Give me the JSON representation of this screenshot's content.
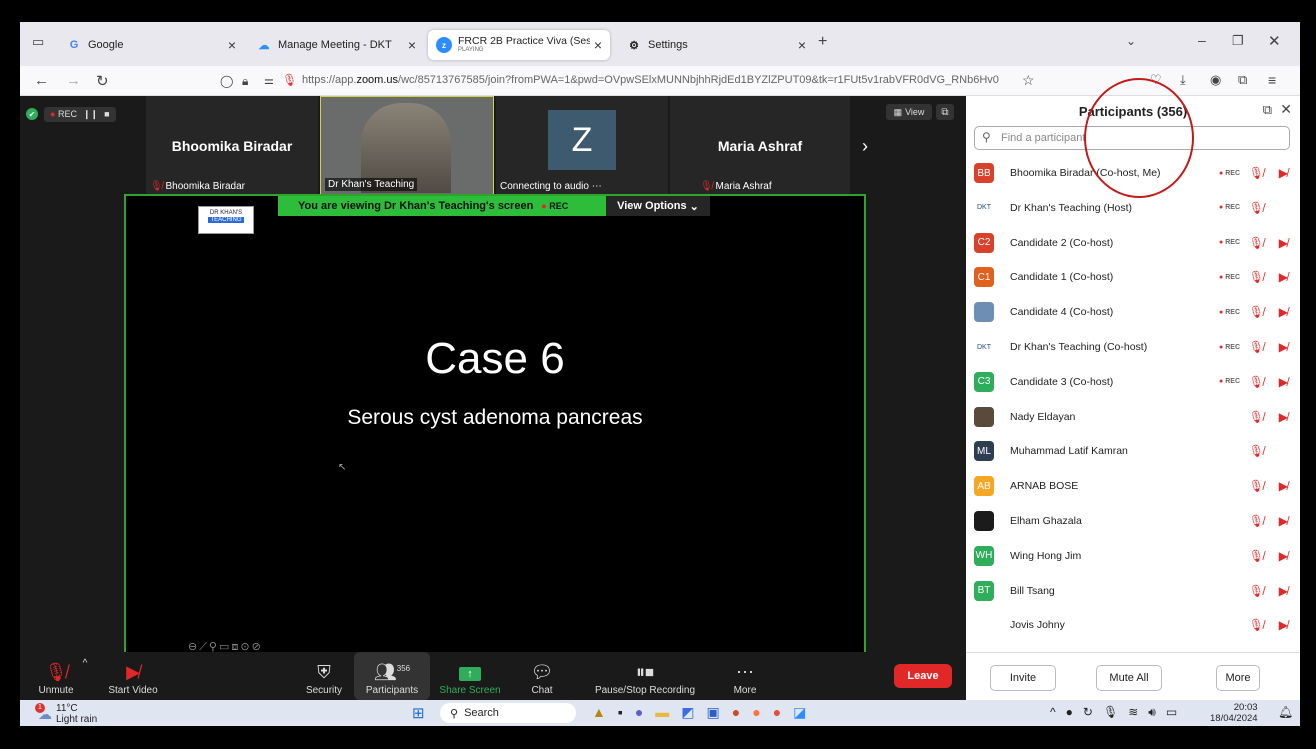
{
  "browser": {
    "tabs": [
      {
        "label": "Google",
        "icon": "google-icon"
      },
      {
        "label": "Manage Meeting - DKT",
        "icon": "zoom-cloud-icon"
      },
      {
        "label": "FRCR 2B Practice Viva (Session",
        "sublabel": "PLAYING",
        "icon": "zoom-icon"
      },
      {
        "label": "Settings",
        "icon": "gear-icon"
      }
    ],
    "url_prefix": "https://app.",
    "url_host": "zoom.us",
    "url_rest": "/wc/85713767585/join?fromPWA=1&pwd=OVpwSElxMUNNbjhhRjdEd1BYZlZPUT09&tk=r1FUt5v1rabVFR0dVG_RNb6Hv0"
  },
  "strip": {
    "rec_label": "REC",
    "tiles": [
      {
        "name": "Bhoomika Biradar",
        "label": "Bhoomika Biradar"
      },
      {
        "name": "",
        "label": "Dr Khan's Teaching"
      },
      {
        "name": "Z",
        "label": "Connecting to audio"
      },
      {
        "name": "Maria Ashraf",
        "label": "Maria Ashraf"
      }
    ],
    "view_label": "View"
  },
  "share": {
    "banner": "You are viewing  Dr Khan's Teaching's screen",
    "banner_rec": "REC",
    "view_options": "View Options",
    "logo_line1": "DR KHAN'S",
    "logo_line2": "TEACHING",
    "case_title": "Case 6",
    "case_subtitle": "Serous cyst adenoma pancreas"
  },
  "toolbar": {
    "unmute": "Unmute",
    "start_video": "Start Video",
    "security": "Security",
    "participants": "Participants",
    "participants_count": "356",
    "share_screen": "Share Screen",
    "chat": "Chat",
    "recording": "Pause/Stop Recording",
    "more": "More",
    "leave": "Leave"
  },
  "panel": {
    "title": "Participants (356)",
    "search_placeholder": "Find a participant",
    "rec": "REC",
    "participants": [
      {
        "initials": "BB",
        "color": "#d9412c",
        "name": "Bhoomika Biradar (Co-host, Me)",
        "rec": true,
        "cam": true
      },
      {
        "initials": "DKT",
        "color": "#ffffff",
        "name": "Dr Khan's Teaching (Host)",
        "rec": true,
        "cam": false
      },
      {
        "initials": "C2",
        "color": "#d9412c",
        "name": "Candidate 2 (Co-host)",
        "rec": true,
        "cam": true
      },
      {
        "initials": "C1",
        "color": "#e0601e",
        "name": "Candidate 1 (Co-host)",
        "rec": true,
        "cam": true
      },
      {
        "initials": "",
        "color": "#6d8fb4",
        "name": "Candidate 4 (Co-host)",
        "rec": true,
        "cam": true
      },
      {
        "initials": "DKT",
        "color": "#ffffff",
        "name": "Dr Khan's Teaching (Co-host)",
        "rec": true,
        "cam": true
      },
      {
        "initials": "C3",
        "color": "#2eae5a",
        "name": "Candidate 3 (Co-host)",
        "rec": true,
        "cam": true
      },
      {
        "initials": "",
        "color": "#5a4a3c",
        "name": "Nady Eldayan",
        "rec": false,
        "cam": true
      },
      {
        "initials": "ML",
        "color": "#2f3d52",
        "name": "Muhammad Latif Kamran",
        "rec": false,
        "cam": false
      },
      {
        "initials": "AB",
        "color": "#f5a623",
        "name": "ARNAB BOSE",
        "rec": false,
        "cam": true
      },
      {
        "initials": "",
        "color": "#1b1b1b",
        "name": "Elham Ghazala",
        "rec": false,
        "cam": true
      },
      {
        "initials": "WH",
        "color": "#2eae5a",
        "name": "Wing Hong Jim",
        "rec": false,
        "cam": true
      },
      {
        "initials": "BT",
        "color": "#2eae5a",
        "name": "Bill Tsang",
        "rec": false,
        "cam": true
      },
      {
        "initials": "",
        "color": "#ffffff",
        "name": "Jovis Johny",
        "rec": false,
        "cam": true
      }
    ],
    "invite": "Invite",
    "mute_all": "Mute All",
    "more": "More"
  },
  "taskbar": {
    "temp": "11°C",
    "weather": "Light rain",
    "weather_badge": "1",
    "search": "Search",
    "time": "20:03",
    "date": "18/04/2024"
  }
}
